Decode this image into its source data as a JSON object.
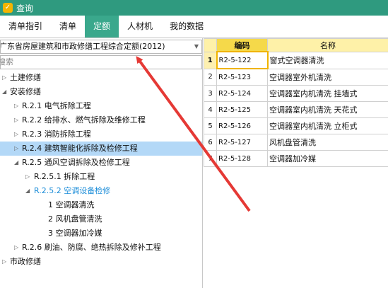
{
  "window": {
    "title": "查询",
    "app_icon": "app-icon"
  },
  "tabs": [
    {
      "label": "清单指引",
      "active": false
    },
    {
      "label": "清单",
      "active": false
    },
    {
      "label": "定额",
      "active": true
    },
    {
      "label": "人材机",
      "active": false
    },
    {
      "label": "我的数据",
      "active": false
    }
  ],
  "left_panel": {
    "quota_select": {
      "value": "广东省房屋建筑和市政修缮工程综合定额(2012)"
    },
    "search": {
      "placeholder": "搜索"
    },
    "tree": [
      {
        "label": "土建修缮",
        "toggle": "▷",
        "level": 0
      },
      {
        "label": "安装修缮",
        "toggle": "◢",
        "level": 0
      },
      {
        "label": "R.2.1 电气拆除工程",
        "toggle": "▷",
        "level": 1
      },
      {
        "label": "R.2.2 给排水、燃气拆除及维修工程",
        "toggle": "▷",
        "level": 1
      },
      {
        "label": "R.2.3 消防拆除工程",
        "toggle": "▷",
        "level": 1
      },
      {
        "label": "R.2.4 建筑智能化拆除及检修工程",
        "toggle": "▷",
        "level": 1,
        "selected": true
      },
      {
        "label": "R.2.5 通风空调拆除及检修工程",
        "toggle": "◢",
        "level": 1
      },
      {
        "label": "R.2.5.1 拆除工程",
        "toggle": "▷",
        "level": 2
      },
      {
        "label": "R.2.5.2 空调设备检修",
        "toggle": "◢",
        "level": 2,
        "highlight": true
      },
      {
        "label": "1 空调器清洗",
        "toggle": "",
        "level": 3
      },
      {
        "label": "2 风机盘管清洗",
        "toggle": "",
        "level": 3
      },
      {
        "label": "3 空调器加冷媒",
        "toggle": "",
        "level": 3
      },
      {
        "label": "R.2.6 刷油、防腐、绝热拆除及修补工程",
        "toggle": "▷",
        "level": 1
      },
      {
        "label": "市政修缮",
        "toggle": "▷",
        "level": 0
      }
    ]
  },
  "right_panel": {
    "columns": {
      "code": "编码",
      "name": "名称"
    },
    "rows": [
      {
        "no": "1",
        "code": "R2-5-122",
        "name": "窗式空调器清洗",
        "current": true
      },
      {
        "no": "2",
        "code": "R2-5-123",
        "name": "空调器室外机清洗"
      },
      {
        "no": "3",
        "code": "R2-5-124",
        "name": "空调器室内机清洗 挂墙式"
      },
      {
        "no": "4",
        "code": "R2-5-125",
        "name": "空调器室内机清洗 天花式"
      },
      {
        "no": "5",
        "code": "R2-5-126",
        "name": "空调器室内机清洗 立柜式"
      },
      {
        "no": "6",
        "code": "R2-5-127",
        "name": "风机盘管清洗"
      },
      {
        "no": "7",
        "code": "R2-5-128",
        "name": "空调器加冷媒"
      }
    ]
  },
  "annotation": {
    "color": "#e53935"
  }
}
